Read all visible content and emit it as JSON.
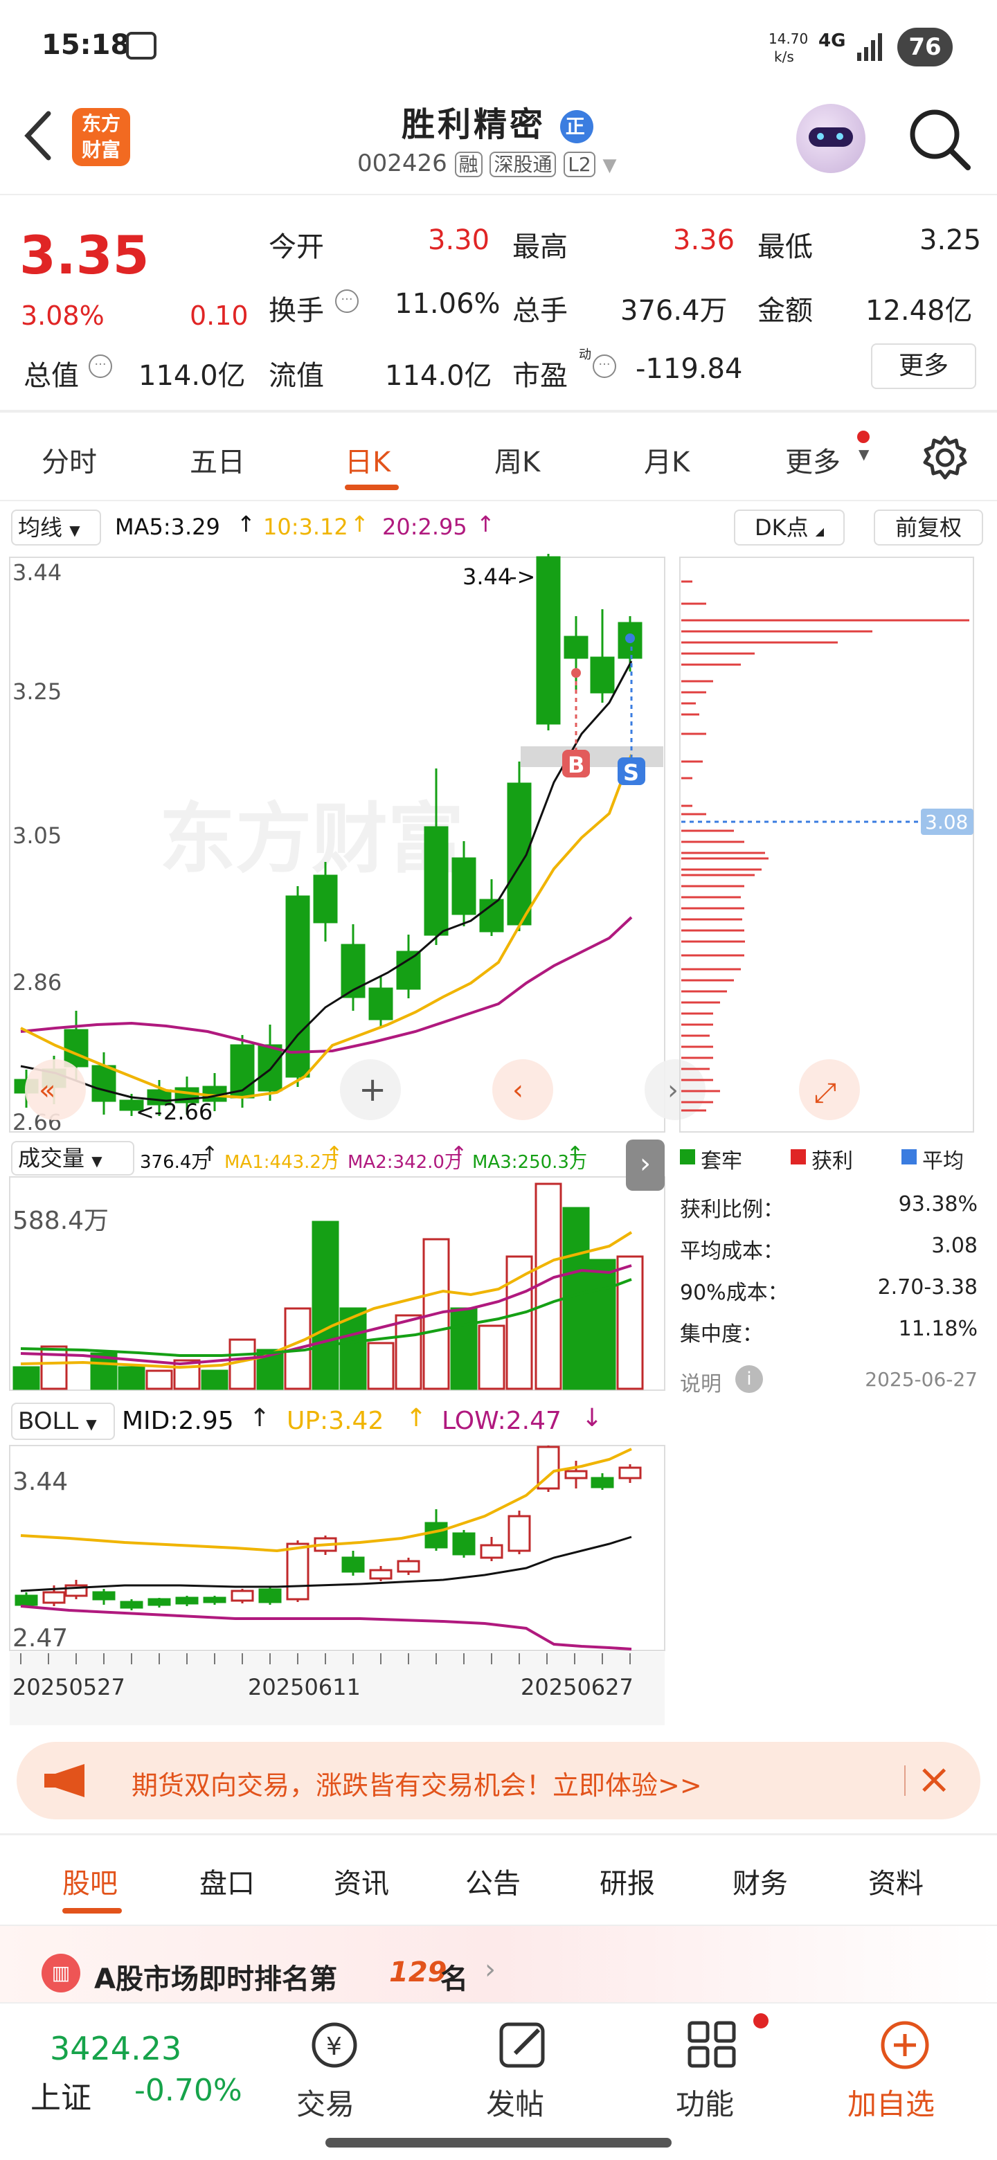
{
  "status_bar": {
    "time": "15:18",
    "speed_top": "14.70",
    "speed_bottom": "k/s",
    "network": "4G",
    "battery": "76"
  },
  "header": {
    "logo_line1": "东方",
    "logo_line2": "财富",
    "title": "胜利精密",
    "title_badge": "正",
    "code": "002426",
    "tags": [
      "融",
      "深股通",
      "L2"
    ]
  },
  "quote": {
    "price": "3.35",
    "change_pct": "3.08%",
    "change_amt": "0.10",
    "open_label": "今开",
    "open": "3.30",
    "high_label": "最高",
    "high": "3.36",
    "low_label": "最低",
    "low": "3.25",
    "turnover_label": "换手",
    "turnover": "11.06%",
    "volume_label": "总手",
    "volume": "376.4万",
    "amount_label": "金额",
    "amount": "12.48亿",
    "mktcap_label": "总值",
    "mktcap": "114.0亿",
    "float_label": "流值",
    "float": "114.0亿",
    "pe_label": "市盈",
    "pe_sup": "动",
    "pe": "-119.84",
    "more": "更多"
  },
  "period_tabs": [
    "分时",
    "五日",
    "日K",
    "周K",
    "月K",
    "更多"
  ],
  "ma_bar": {
    "selector": "均线",
    "ma5": "MA5:3.29",
    "ma10": "10:3.12",
    "ma20": "20:2.95",
    "dk": "DK点",
    "fq": "前复权"
  },
  "main_chart": {
    "y_labels": [
      "3.44",
      "3.25",
      "3.05",
      "2.86",
      "2.66"
    ],
    "high_marker": "3.44",
    "low_marker": "2.66",
    "cost_line": "3.08",
    "watermark": "东方财富",
    "b_label": "B",
    "s_label": "S"
  },
  "legend_right": {
    "trapped": "套牢",
    "profit": "获利",
    "avg": "平均"
  },
  "vol_bar": {
    "selector": "成交量",
    "vol": "376.4万",
    "ma1": "MA1:443.2万",
    "ma2": "MA2:342.0万",
    "ma3": "MA3:250.3万",
    "max_label": "588.4万"
  },
  "cost_stats": {
    "rows": [
      {
        "label": "获利比例：",
        "value": "93.38%"
      },
      {
        "label": "平均成本：",
        "value": "3.08"
      },
      {
        "label": "90%成本：",
        "value": "2.70-3.38"
      },
      {
        "label": "集中度：",
        "value": "11.18%"
      }
    ],
    "note": "说明",
    "date": "2025-06-27"
  },
  "boll_bar": {
    "selector": "BOLL",
    "mid": "MID:2.95",
    "up": "UP:3.42",
    "low": "LOW:2.47",
    "y_top": "3.44",
    "y_bottom": "2.47"
  },
  "dates": [
    "20250527",
    "20250611",
    "20250627"
  ],
  "ad": {
    "text": "期货双向交易，涨跌皆有交易机会！立即体验>>"
  },
  "section_tabs": [
    "股吧",
    "盘口",
    "资讯",
    "公告",
    "研报",
    "财务",
    "资料"
  ],
  "ranking": {
    "text_prefix": "A股市场即时排名第",
    "rank": "129",
    "text_suffix": "名"
  },
  "bottom_bar": {
    "index_value": "3424.23",
    "index_name": "上证",
    "index_change": "-0.70%",
    "trade": "交易",
    "post": "发帖",
    "func": "功能",
    "add": "加自选"
  },
  "colors": {
    "up": "#c0292b",
    "down": "#15a015",
    "accent": "#e2531b",
    "ma5": "#111111",
    "ma10": "#f0b400",
    "ma20": "#b0197e"
  }
}
